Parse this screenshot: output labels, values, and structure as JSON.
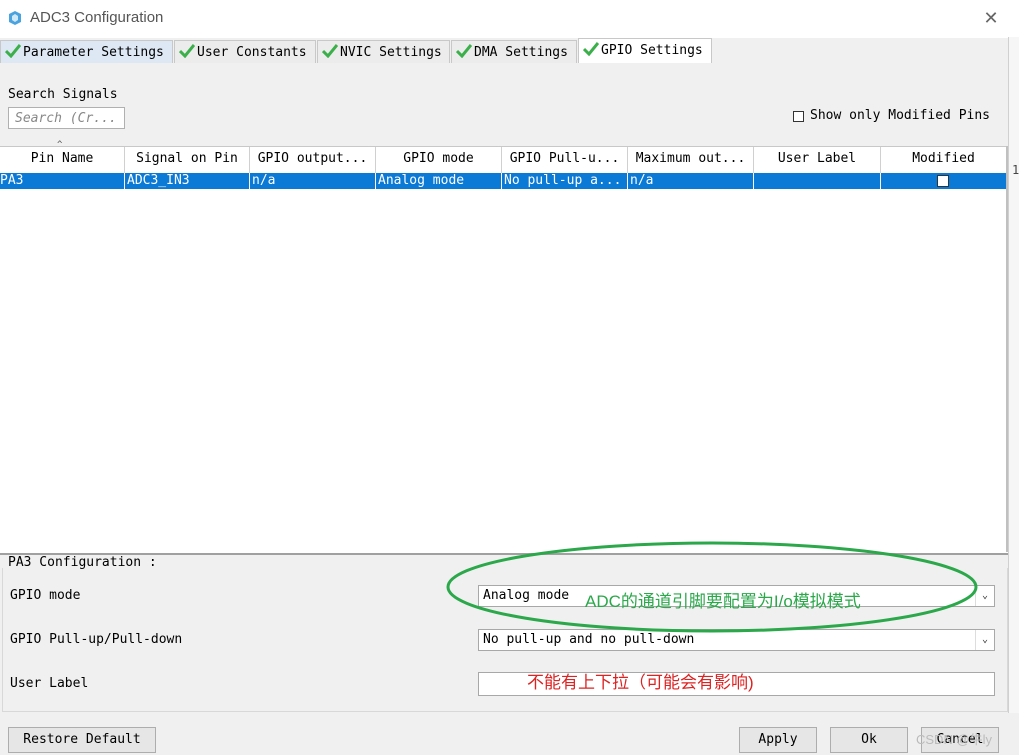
{
  "window": {
    "title": "ADC3 Configuration",
    "close_symbol": "✕"
  },
  "tabs": [
    {
      "label": "Parameter Settings"
    },
    {
      "label": "User Constants"
    },
    {
      "label": "NVIC Settings"
    },
    {
      "label": "DMA Settings"
    },
    {
      "label": "GPIO Settings"
    }
  ],
  "search": {
    "label": "Search Signals",
    "placeholder": "Search (Cr..."
  },
  "show_modified": {
    "label": "Show only Modified Pins",
    "checked": false
  },
  "table": {
    "headers": [
      "Pin Name",
      "Signal on Pin",
      "GPIO output...",
      "GPIO mode",
      "GPIO Pull-u...",
      "Maximum out...",
      "User Label",
      "Modified"
    ],
    "sort_indicator": "^",
    "rows": [
      {
        "pin": "PA3",
        "signal": "ADC3_IN3",
        "gpio_output": "n/a",
        "gpio_mode": "Analog mode",
        "pull": "No pull-up a...",
        "max_out": "n/a",
        "user_label": "",
        "modified": false
      }
    ]
  },
  "config": {
    "title": "PA3 Configuration :",
    "gpio_mode_label": "GPIO mode",
    "gpio_mode_value": "Analog mode",
    "pull_label": "GPIO Pull-up/Pull-down",
    "pull_value": "No pull-up and no pull-down",
    "user_label_label": "User Label",
    "user_label_value": ""
  },
  "annotations": {
    "green_note": "ADC的通道引脚要配置为I/o模拟模式",
    "red_note": "不能有上下拉（可能会有影响)",
    "green_color": "#2aa84a",
    "red_color": "#dd2222"
  },
  "buttons": {
    "restore": "Restore Default",
    "apply": "Apply",
    "ok": "Ok",
    "cancel": "Cancel"
  },
  "watermark": "CSDN @牛ly",
  "right_edge_mark": "1",
  "colors": {
    "selection": "#0a7ad6",
    "check_green": "#3bb04a"
  }
}
